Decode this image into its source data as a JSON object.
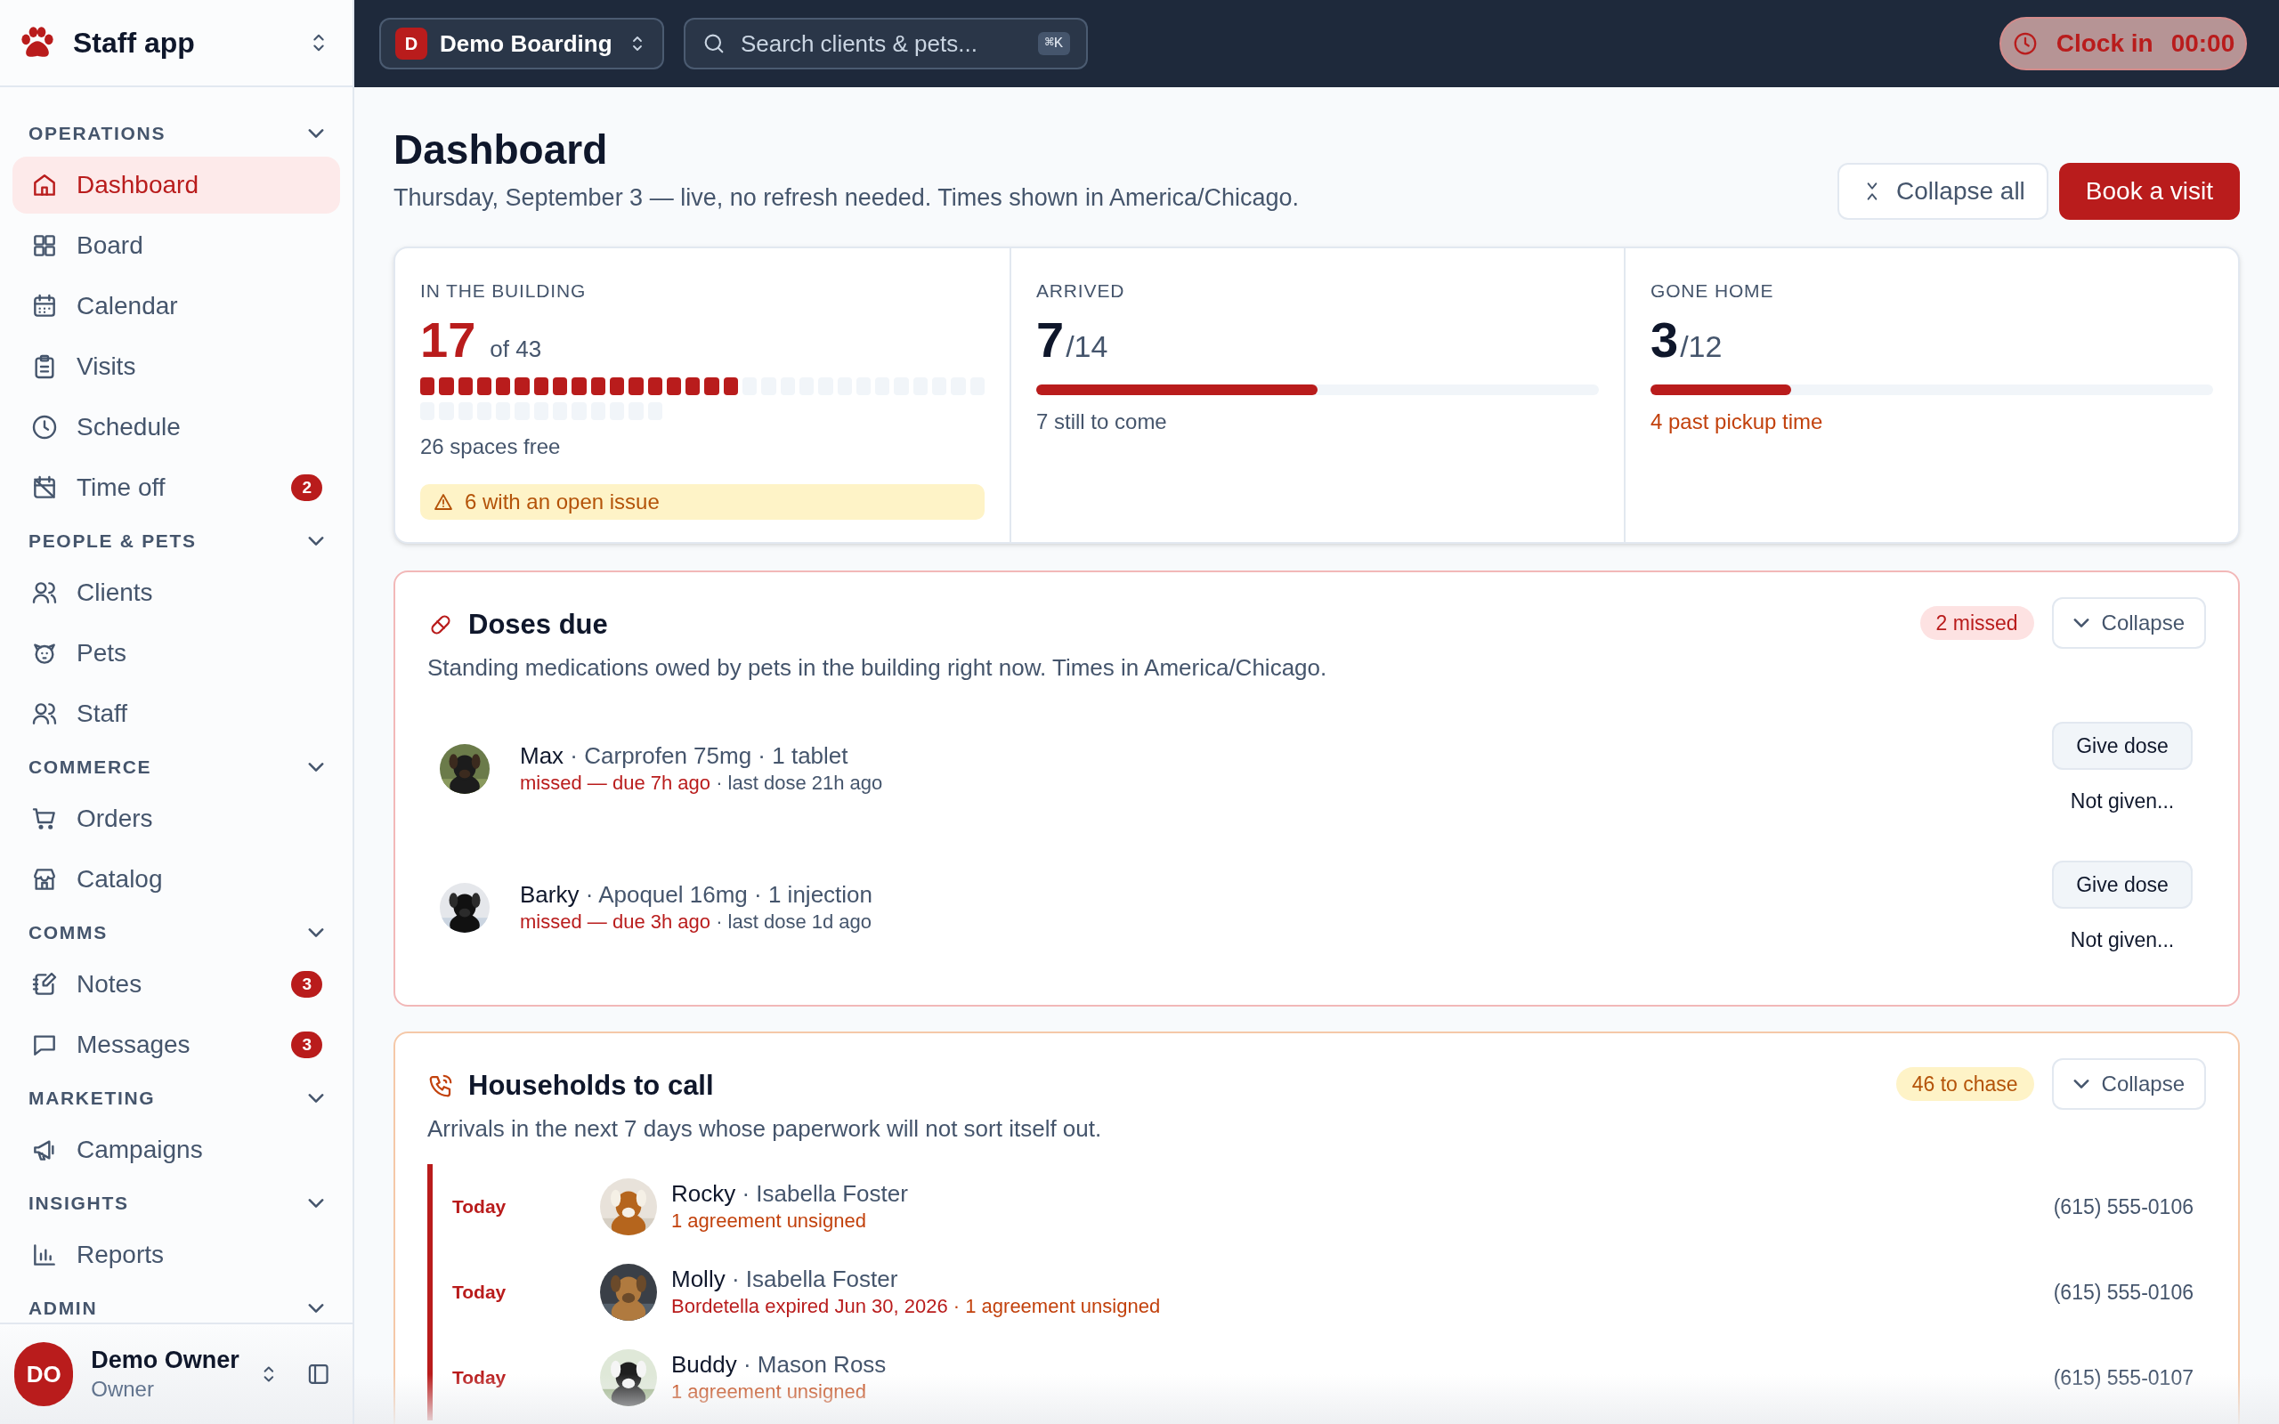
{
  "sidebar": {
    "app_name": "Staff app",
    "sections": [
      {
        "title": "OPERATIONS",
        "expanded": true,
        "items": [
          {
            "label": "Dashboard",
            "selected": true
          },
          {
            "label": "Board",
            "selected": false
          },
          {
            "label": "Calendar",
            "selected": false
          },
          {
            "label": "Visits",
            "selected": false
          },
          {
            "label": "Schedule",
            "selected": false
          },
          {
            "label": "Time off",
            "selected": false,
            "badge": "2"
          }
        ]
      },
      {
        "title": "PEOPLE & PETS",
        "expanded": true,
        "items": [
          {
            "label": "Clients",
            "selected": false
          },
          {
            "label": "Pets",
            "selected": false
          },
          {
            "label": "Staff",
            "selected": false
          }
        ]
      },
      {
        "title": "COMMERCE",
        "expanded": true,
        "items": [
          {
            "label": "Orders",
            "selected": false
          },
          {
            "label": "Catalog",
            "selected": false
          }
        ]
      },
      {
        "title": "COMMS",
        "expanded": true,
        "items": [
          {
            "label": "Notes",
            "selected": false,
            "badge": "3"
          },
          {
            "label": "Messages",
            "selected": false,
            "badge": "3"
          }
        ]
      },
      {
        "title": "MARKETING",
        "expanded": true,
        "items": [
          {
            "label": "Campaigns",
            "selected": false
          }
        ]
      },
      {
        "title": "INSIGHTS",
        "expanded": true,
        "items": [
          {
            "label": "Reports",
            "selected": false
          }
        ]
      },
      {
        "title": "ADMIN",
        "expanded": true
      }
    ],
    "user": {
      "initials": "DO",
      "name": "Demo Owner",
      "role": "Owner"
    }
  },
  "topbar": {
    "workspace_initial": "D",
    "workspace": "Demo Boarding",
    "search": {
      "placeholder": "Search clients & pets...",
      "shortcut": "⌘K"
    },
    "clock": {
      "label": "Clock in",
      "time": "00:00"
    }
  },
  "header": {
    "title": "Dashboard",
    "subtitle": "Thursday, September 3 — live, no refresh needed. Times shown in America/Chicago.",
    "buttons": [
      {
        "label": "Collapse all",
        "kind": "secondary"
      },
      {
        "label": "Book a visit",
        "kind": "primary"
      }
    ]
  },
  "stats": [
    {
      "label": "IN THE BUILDING",
      "kind": "segments",
      "value": "17",
      "total": "of 43",
      "highlight": true,
      "spaces": [
        {
          "occupied": true
        },
        {
          "occupied": true
        },
        {
          "occupied": true
        },
        {
          "occupied": true
        },
        {
          "occupied": true
        },
        {
          "occupied": true
        },
        {
          "occupied": true
        },
        {
          "occupied": true
        },
        {
          "occupied": true
        },
        {
          "occupied": true
        },
        {
          "occupied": true
        },
        {
          "occupied": true
        },
        {
          "occupied": true
        },
        {
          "occupied": true
        },
        {
          "occupied": true
        },
        {
          "occupied": true
        },
        {
          "occupied": true
        },
        {
          "occupied": false
        },
        {
          "occupied": false
        },
        {
          "occupied": false
        },
        {
          "occupied": false
        },
        {
          "occupied": false
        },
        {
          "occupied": false
        },
        {
          "occupied": false
        },
        {
          "occupied": false
        },
        {
          "occupied": false
        },
        {
          "occupied": false
        },
        {
          "occupied": false
        },
        {
          "occupied": false
        },
        {
          "occupied": false
        },
        {
          "occupied": false
        },
        {
          "occupied": false
        },
        {
          "occupied": false
        },
        {
          "occupied": false
        },
        {
          "occupied": false
        },
        {
          "occupied": false
        },
        {
          "occupied": false
        },
        {
          "occupied": false
        },
        {
          "occupied": false
        },
        {
          "occupied": false
        },
        {
          "occupied": false
        },
        {
          "occupied": false
        },
        {
          "occupied": false
        }
      ],
      "note": "26 spaces free",
      "warning": false,
      "alert": "6 with an open issue"
    },
    {
      "label": "ARRIVED",
      "kind": "bar",
      "value": "7",
      "total": "/14",
      "highlight": false,
      "level": 0.5,
      "note": "7 still to come",
      "warning": false
    },
    {
      "label": "GONE HOME",
      "kind": "bar",
      "value": "3",
      "total": "/12",
      "highlight": false,
      "level": 0.25,
      "note": "4 past pickup time",
      "warning": true
    }
  ],
  "doses": {
    "title": "Doses due",
    "subtitle": "Standing medications owed by pets in the building right now. Times in America/Chicago.",
    "badge": "2 missed",
    "collapse": "Collapse",
    "rows": [
      {
        "pet": "Max",
        "details": "· Carprofen 75mg · 1 tablet",
        "missed": true,
        "status": "missed — due 7h ago",
        "last": "· last dose 21h ago",
        "give": "Give dose",
        "skip": "Not given..."
      },
      {
        "pet": "Barky",
        "details": "· Apoquel 16mg · 1 injection",
        "missed": true,
        "status": "missed — due 3h ago",
        "last": "· last dose 1d ago",
        "give": "Give dose",
        "skip": "Not given..."
      }
    ]
  },
  "households": {
    "title": "Households to call",
    "subtitle": "Arrivals in the next 7 days whose paperwork will not sort itself out.",
    "badge": "46 to chase",
    "collapse": "Collapse",
    "rows": [
      {
        "when": "Today",
        "pet": "Rocky",
        "owner": "· Isabella Foster",
        "issues": [
          {
            "text": "1 agreement unsigned",
            "kind": "unsigned"
          }
        ],
        "phone": "(615) 555-0106"
      },
      {
        "when": "Today",
        "pet": "Molly",
        "owner": "· Isabella Foster",
        "issues": [
          {
            "text": "Bordetella expired Jun 30, 2026",
            "kind": "expired"
          },
          {
            "text": "· 1 agreement unsigned",
            "kind": "unsigned"
          }
        ],
        "phone": "(615) 555-0106"
      },
      {
        "when": "Today",
        "pet": "Buddy",
        "owner": "· Mason Ross",
        "issues": [
          {
            "text": "1 agreement unsigned",
            "kind": "unsigned"
          }
        ],
        "phone": "(615) 555-0107"
      }
    ]
  }
}
